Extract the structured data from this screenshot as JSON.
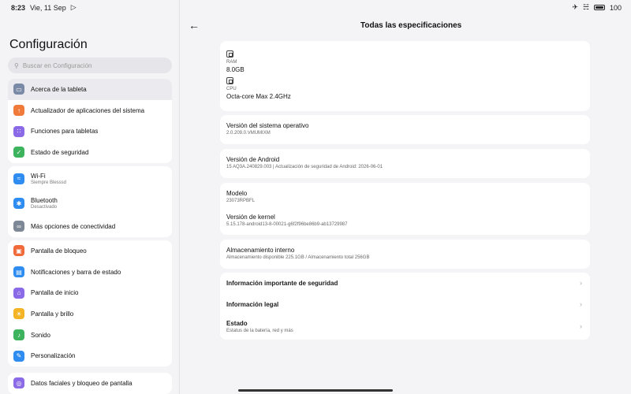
{
  "status_bar": {
    "time": "8:23",
    "date": "Vie, 11 Sep",
    "battery": "100"
  },
  "sidebar": {
    "title": "Configuración",
    "search_placeholder": "Buscar en Configuración",
    "groups": [
      {
        "items": [
          {
            "label": "Acerca de la tableta",
            "icon": "tablet-icon",
            "color": "#7a8aa6",
            "selected": true
          },
          {
            "label": "Actualizador de aplicaciones del sistema",
            "icon": "arrow-up-icon",
            "color": "#f07a3a"
          },
          {
            "label": "Funciones para tabletas",
            "icon": "grid-icon",
            "color": "#8a6ae6"
          },
          {
            "label": "Estado de seguridad",
            "icon": "shield-check-icon",
            "color": "#3cb35c"
          }
        ]
      },
      {
        "items": [
          {
            "label": "Wi-Fi",
            "sub": "Siempre Blesssd",
            "icon": "wifi-icon",
            "color": "#2f8cf0"
          },
          {
            "label": "Bluetooth",
            "sub": "Desactivado",
            "icon": "bluetooth-icon",
            "color": "#2f8cf0"
          },
          {
            "label": "Más opciones de conectividad",
            "icon": "link-icon",
            "color": "#7d8796"
          }
        ]
      },
      {
        "items": [
          {
            "label": "Pantalla de bloqueo",
            "icon": "lock-icon",
            "color": "#f06a3a"
          },
          {
            "label": "Notificaciones y barra de estado",
            "icon": "notification-icon",
            "color": "#2f8cf0"
          },
          {
            "label": "Pantalla de inicio",
            "icon": "home-icon",
            "color": "#8a6ae6"
          },
          {
            "label": "Pantalla y brillo",
            "icon": "sun-icon",
            "color": "#f4b425"
          },
          {
            "label": "Sonido",
            "icon": "sound-icon",
            "color": "#3cb35c"
          },
          {
            "label": "Personalización",
            "icon": "brush-icon",
            "color": "#2f8cf0"
          }
        ]
      },
      {
        "items": [
          {
            "label": "Datos faciales y bloqueo de pantalla",
            "icon": "fingerprint-icon",
            "color": "#8a6ae6"
          }
        ]
      }
    ]
  },
  "detail": {
    "title": "Todas las especificaciones",
    "specs": [
      {
        "label": "RAM",
        "value": "8.0GB",
        "icon": "memory-icon"
      },
      {
        "label": "CPU",
        "value": "Octa-core Max 2.4GHz",
        "icon": "cpu-icon"
      }
    ],
    "os": {
      "title": "Versión del sistema operativo",
      "value": "2.0.209.0.VMUMIXM"
    },
    "android": {
      "title": "Versión de Android",
      "value": "15 AQ3A.240829.003 | Actualización de seguridad de Android: 2026-06-01"
    },
    "model": {
      "title": "Modelo",
      "value": "23073RPBFL"
    },
    "kernel": {
      "title": "Versión de kernel",
      "value": "5.15.178-android13-8-00021-g6f2f96be86b9-ab13729987"
    },
    "storage": {
      "title": "Almacenamiento interno",
      "value": "Almacenamiento disponible  225.1GB / Almacenamiento total  256GB"
    },
    "links": [
      {
        "label": "Información importante de seguridad"
      },
      {
        "label": "Información legal"
      },
      {
        "label": "Estado",
        "sub": "Estatus de la batería, red y más"
      }
    ]
  }
}
